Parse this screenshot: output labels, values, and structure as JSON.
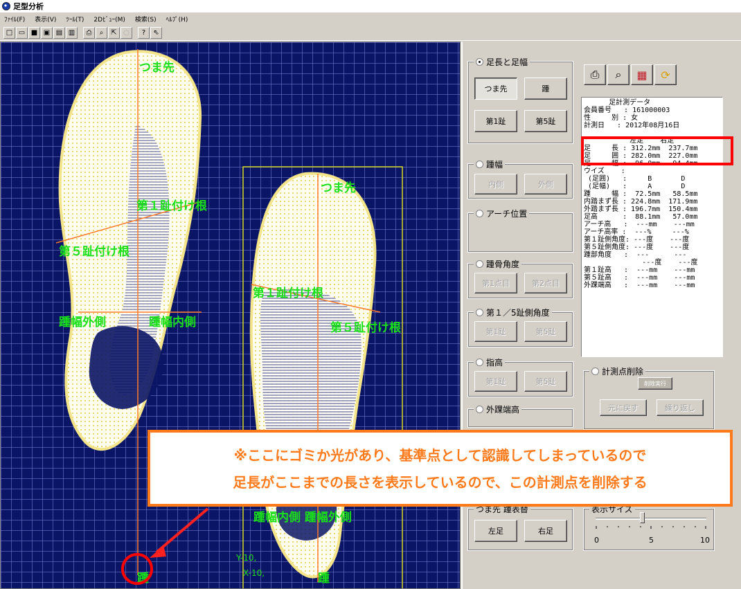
{
  "window": {
    "title": "足型分析"
  },
  "menu": [
    "ﾌｧｲﾙ(F)",
    "表示(V)",
    "ﾂｰﾙ(T)",
    "2Dﾋﾞｭｰ(M)",
    "検索(S)",
    "ﾍﾙﾌﾟ(H)"
  ],
  "toolbar_icons": [
    "new-file",
    "open-folder",
    "save",
    "save-as",
    "save-all",
    "save-other",
    "print",
    "print-preview",
    "export",
    "disabled-tool",
    "help",
    "context-help"
  ],
  "toolbar_glyphs": [
    "□",
    "▭",
    "■",
    "▣",
    "▤",
    "▥",
    "⎙",
    "⌕",
    "⇱",
    "◌",
    "?",
    "⇖"
  ],
  "canvas": {
    "left_labels": {
      "toe": "つま先",
      "ball1": "第１趾付け根",
      "ball5": "第５趾付け根",
      "heel_out": "踵幅外側",
      "heel_in": "踵幅内側",
      "heel": "踵"
    },
    "right_labels": {
      "toe": "つま先",
      "ball1": "第１趾付け根",
      "ball5": "第５趾付け根",
      "heel": "踵",
      "heel_width": "踵幅内側 踵幅外側"
    },
    "coords": {
      "y": "Y-10,",
      "x": "X-10,"
    }
  },
  "panel": {
    "group_length": {
      "caption": "足長と足幅",
      "btn_toe": "つま先",
      "btn_heel": "踵",
      "btn_toe1": "第1趾",
      "btn_toe5": "第5趾"
    },
    "group_heel_width": {
      "caption": "踵幅",
      "btn_inner": "内側",
      "btn_outer": "外側"
    },
    "group_arch": {
      "caption": "アーチ位置"
    },
    "group_heel_angle": {
      "caption": "踵骨角度",
      "btn_pt1": "第1点目",
      "btn_pt2": "第2点目"
    },
    "group_side_angle": {
      "caption": "第１／5趾側角度",
      "btn_toe1": "第1趾",
      "btn_toe5": "第5趾"
    },
    "group_toe_height": {
      "caption": "指高",
      "btn_toe1": "第1趾",
      "btn_toe5": "第5趾"
    },
    "group_malleolus": {
      "caption": "外踝端高"
    },
    "group_delete": {
      "caption": "計測点削除",
      "btn_exec": "削除実行",
      "btn_undo": "元に戻す",
      "btn_redo": "繰り返し"
    },
    "group_display": {
      "caption": "つま先 踵表替",
      "btn_left": "左足",
      "btn_right": "右足"
    },
    "group_size": {
      "caption": "表示サイズ",
      "ticks": [
        "0",
        "5",
        "10"
      ],
      "value": 4
    }
  },
  "icon_buttons": [
    "printer-icon",
    "preview-icon",
    "chart-icon",
    "refresh-icon"
  ],
  "icon_glyphs": [
    "⎙",
    "⌕",
    "▦",
    "⟳"
  ],
  "data_panel": {
    "rows": [
      "      足計測データ",
      "会員番号   : 161000003",
      "性     別 : 女",
      "計測日   : 2012年08月16日",
      "",
      "           左足    右足",
      "足     長 : 312.2mm  237.7mm",
      "足     囲 : 282.0mm  227.0mm",
      "足     幅 :  96.0mm   94.4mm",
      "ウイズ    :",
      " (足囲)   :     B       D",
      " (足幅)   :     A       D",
      "踵     幅 :  72.5mm   58.5mm",
      "内踏まず長 : 224.8mm  171.9mm",
      "外踏まず長 : 196.7mm  150.4mm",
      "足高      :  88.1mm   57.0mm",
      "アーチ高   :  ---mm    ---mm",
      "アーチ高率 :  ---%     ---%",
      "第１趾側角度: ---度    ---度",
      "第５趾側角度: ---度    ---度",
      "踵部角度   :  ---      ---",
      "              ---度    ---度",
      "第１趾高   :  ---mm    ---mm",
      "第５趾高   :  ---mm    ---mm",
      "外踝端高   :  ---mm    ---mm"
    ]
  },
  "callout": {
    "line1": "※ここにゴミか光があり、基準点として認識してしまっているので",
    "line2": "足長がここまでの長さを表示しているので、この計測点を削除する"
  },
  "colors": {
    "canvas_bg": "#0b1565",
    "label_green": "#19e119",
    "axis_orange": "#ff7a2a",
    "callout_orange": "#ff7a1a",
    "highlight_red": "#ff0000",
    "box_yellow": "#d8d820"
  }
}
